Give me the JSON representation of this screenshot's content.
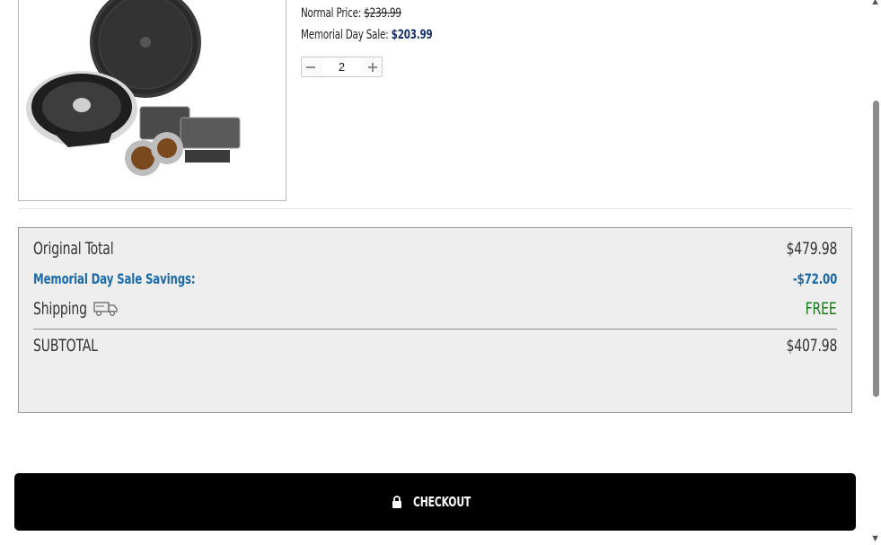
{
  "product": {
    "normal_price_label": "Normal Price:",
    "normal_price": "$239.99",
    "sale_label": "Memorial Day Sale:",
    "sale_price": "$203.99",
    "quantity": "2"
  },
  "summary": {
    "original_total_label": "Original Total",
    "original_total": "$479.98",
    "savings_label": "Memorial Day Sale Savings:",
    "savings": "-$72.00",
    "shipping_label": "Shipping",
    "shipping": "FREE",
    "subtotal_label": "SUBTOTAL",
    "subtotal": "$407.98"
  },
  "checkout": {
    "label": "CHECKOUT"
  },
  "icons": [
    "speaker-kit-image",
    "minus-icon",
    "plus-icon",
    "truck-icon",
    "lock-icon"
  ],
  "colors": {
    "sale_price": "#16306b",
    "savings": "#1c6aa8",
    "free": "#177a17",
    "checkout_bg": "#000000"
  }
}
